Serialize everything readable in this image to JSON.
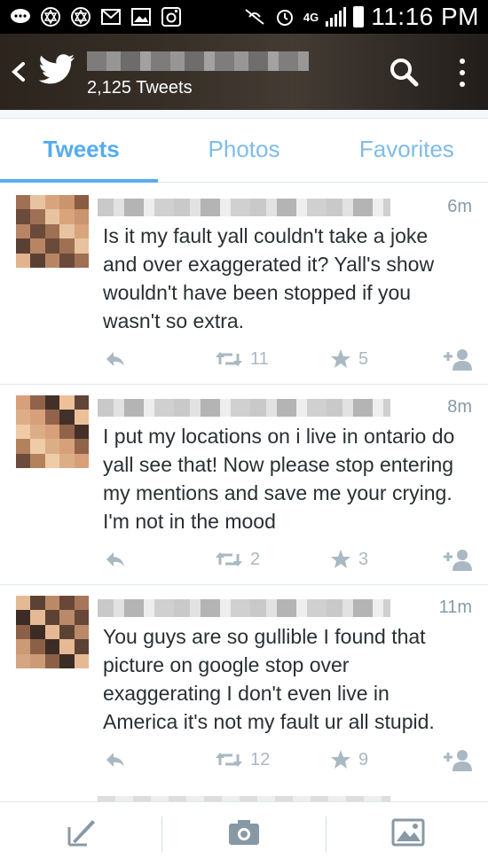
{
  "status_bar": {
    "time": "11:16 PM",
    "network": "4G"
  },
  "header": {
    "tweet_count": "2,125 Tweets"
  },
  "tabs": [
    {
      "label": "Tweets",
      "active": true
    },
    {
      "label": "Photos",
      "active": false
    },
    {
      "label": "Favorites",
      "active": false
    }
  ],
  "tweets": [
    {
      "time": "6m",
      "text": "Is it my fault yall couldn't take a joke and over exaggerated it? Yall's show wouldn't have been stopped if you wasn't so extra.",
      "retweets": "11",
      "favorites": "5"
    },
    {
      "time": "8m",
      "text": "I put my locations on i live in ontario do yall see that! Now please stop entering my mentions and save me your crying. I'm not in the mood",
      "retweets": "2",
      "favorites": "3"
    },
    {
      "time": "11m",
      "text": "You guys are so gullible I found that picture on google stop over exaggerating I don't even live in America it's not my fault ur all stupid.",
      "retweets": "12",
      "favorites": "9"
    }
  ],
  "colors": {
    "accent": "#55acee",
    "action_gray": "#aab8c2",
    "text": "#292f33"
  }
}
